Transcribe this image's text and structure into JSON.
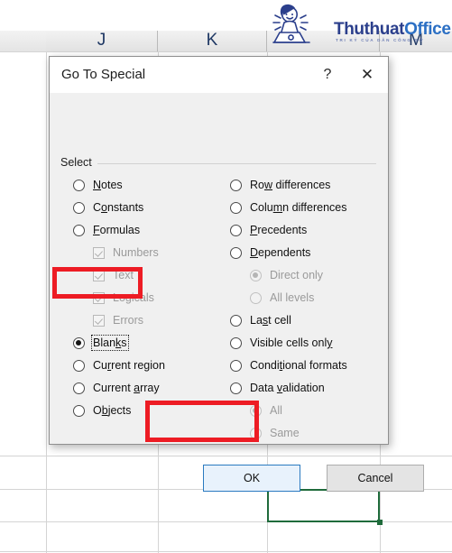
{
  "spreadsheet": {
    "column_headers": [
      "J",
      "K",
      "M"
    ],
    "selected_cell_outline_color": "#1f6b3b"
  },
  "watermark": {
    "brand_part1": "Thuthuat",
    "brand_part2": "Office",
    "tagline": "TRI KỶ CỦA DÂN CÔNG SỞ"
  },
  "dialog": {
    "title": "Go To Special",
    "help_icon": "?",
    "close_icon": "✕",
    "group_label": "Select",
    "left_options": [
      {
        "label": "Notes",
        "accel": "N",
        "type": "radio",
        "state": "unchecked",
        "indent": 0,
        "disabled": false
      },
      {
        "label": "Constants",
        "accel": "o",
        "type": "radio",
        "state": "unchecked",
        "indent": 0,
        "disabled": false
      },
      {
        "label": "Formulas",
        "accel": "F",
        "type": "radio",
        "state": "unchecked",
        "indent": 0,
        "disabled": false
      },
      {
        "label": "Numbers",
        "accel": "",
        "type": "checkbox",
        "state": "checked",
        "indent": 1,
        "disabled": true
      },
      {
        "label": "Text",
        "accel": "",
        "type": "checkbox",
        "state": "checked",
        "indent": 1,
        "disabled": true
      },
      {
        "label": "Logicals",
        "accel": "",
        "type": "checkbox",
        "state": "checked",
        "indent": 1,
        "disabled": true
      },
      {
        "label": "Errors",
        "accel": "",
        "type": "checkbox",
        "state": "checked",
        "indent": 1,
        "disabled": true
      },
      {
        "label": "Blanks",
        "accel": "k",
        "type": "radio",
        "state": "checked",
        "indent": 0,
        "disabled": false
      },
      {
        "label": "Current region",
        "accel": "r",
        "type": "radio",
        "state": "unchecked",
        "indent": 0,
        "disabled": false
      },
      {
        "label": "Current array",
        "accel": "a",
        "type": "radio",
        "state": "unchecked",
        "indent": 0,
        "disabled": false
      },
      {
        "label": "Objects",
        "accel": "b",
        "type": "radio",
        "state": "unchecked",
        "indent": 0,
        "disabled": false
      }
    ],
    "right_options": [
      {
        "label": "Row differences",
        "accel": "w",
        "type": "radio",
        "state": "unchecked",
        "indent": 0,
        "disabled": false
      },
      {
        "label": "Column differences",
        "accel": "m",
        "type": "radio",
        "state": "unchecked",
        "indent": 0,
        "disabled": false
      },
      {
        "label": "Precedents",
        "accel": "P",
        "type": "radio",
        "state": "unchecked",
        "indent": 0,
        "disabled": false
      },
      {
        "label": "Dependents",
        "accel": "D",
        "type": "radio",
        "state": "unchecked",
        "indent": 0,
        "disabled": false
      },
      {
        "label": "Direct only",
        "accel": "",
        "type": "radio",
        "state": "checked",
        "indent": 1,
        "disabled": true
      },
      {
        "label": "All levels",
        "accel": "",
        "type": "radio",
        "state": "unchecked",
        "indent": 1,
        "disabled": true
      },
      {
        "label": "Last cell",
        "accel": "s",
        "type": "radio",
        "state": "unchecked",
        "indent": 0,
        "disabled": false
      },
      {
        "label": "Visible cells only",
        "accel": "y",
        "type": "radio",
        "state": "unchecked",
        "indent": 0,
        "disabled": false
      },
      {
        "label": "Conditional formats",
        "accel": "t",
        "type": "radio",
        "state": "unchecked",
        "indent": 0,
        "disabled": false
      },
      {
        "label": "Data validation",
        "accel": "v",
        "type": "radio",
        "state": "unchecked",
        "indent": 0,
        "disabled": false
      },
      {
        "label": "All",
        "accel": "",
        "type": "radio",
        "state": "checked",
        "indent": 1,
        "disabled": true
      },
      {
        "label": "Same",
        "accel": "",
        "type": "radio",
        "state": "unchecked",
        "indent": 1,
        "disabled": true
      }
    ],
    "ok_label": "OK",
    "cancel_label": "Cancel"
  },
  "annotations": {
    "highlight_color": "#ED1C24",
    "boxes": [
      "blanks-option",
      "ok-button"
    ]
  }
}
